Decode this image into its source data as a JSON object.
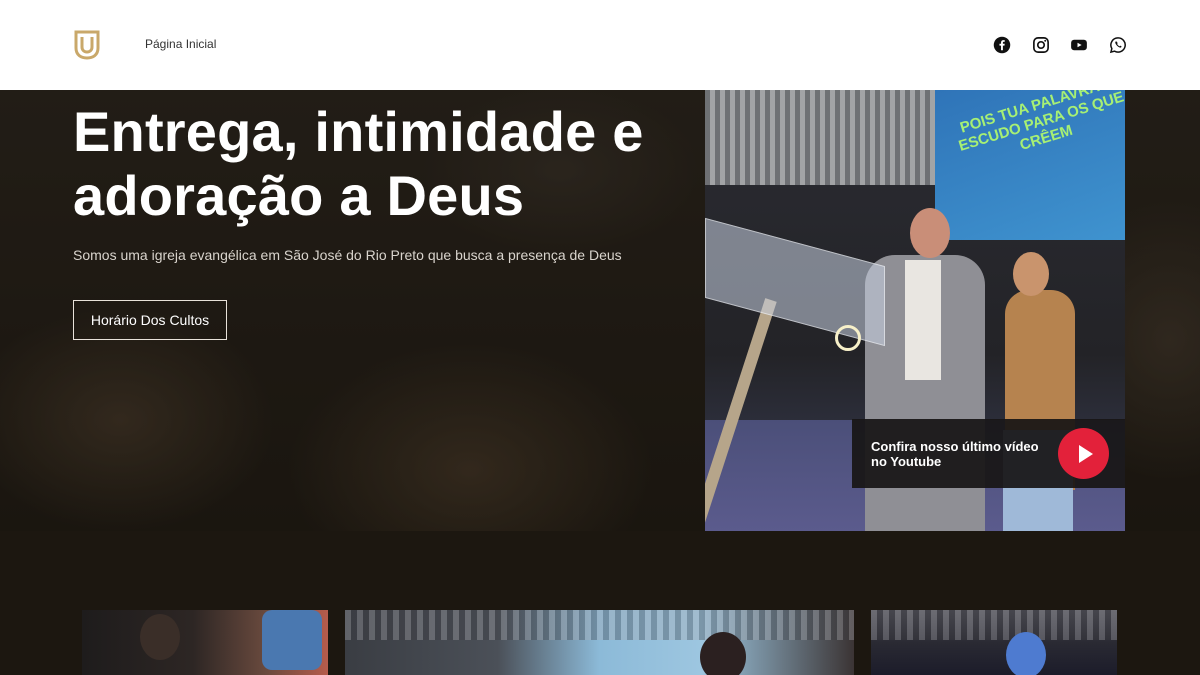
{
  "header": {
    "logo_name": "church-logo",
    "nav": [
      {
        "label": "Página Inicial"
      }
    ],
    "social": [
      {
        "icon": "facebook-icon"
      },
      {
        "icon": "instagram-icon"
      },
      {
        "icon": "youtube-icon"
      },
      {
        "icon": "whatsapp-icon"
      }
    ]
  },
  "hero": {
    "title": "Entrega, intimidade e adoração a Deus",
    "subtitle": "Somos uma igreja evangélica em São José do Rio Preto que busca a presença de Deus",
    "button_label": "Horário Dos Cultos",
    "stage_screen_text": "POIS TUA PALAVRA É ESCUDO PARA OS QUE CRÊEM"
  },
  "video_cta": {
    "text": "Confira nosso último vídeo no Youtube",
    "icon": "play-icon"
  },
  "colors": {
    "accent_red": "#e3213a",
    "logo_gold": "#c9a86a",
    "header_bg": "#ffffff",
    "hero_bg": "#241e17"
  }
}
